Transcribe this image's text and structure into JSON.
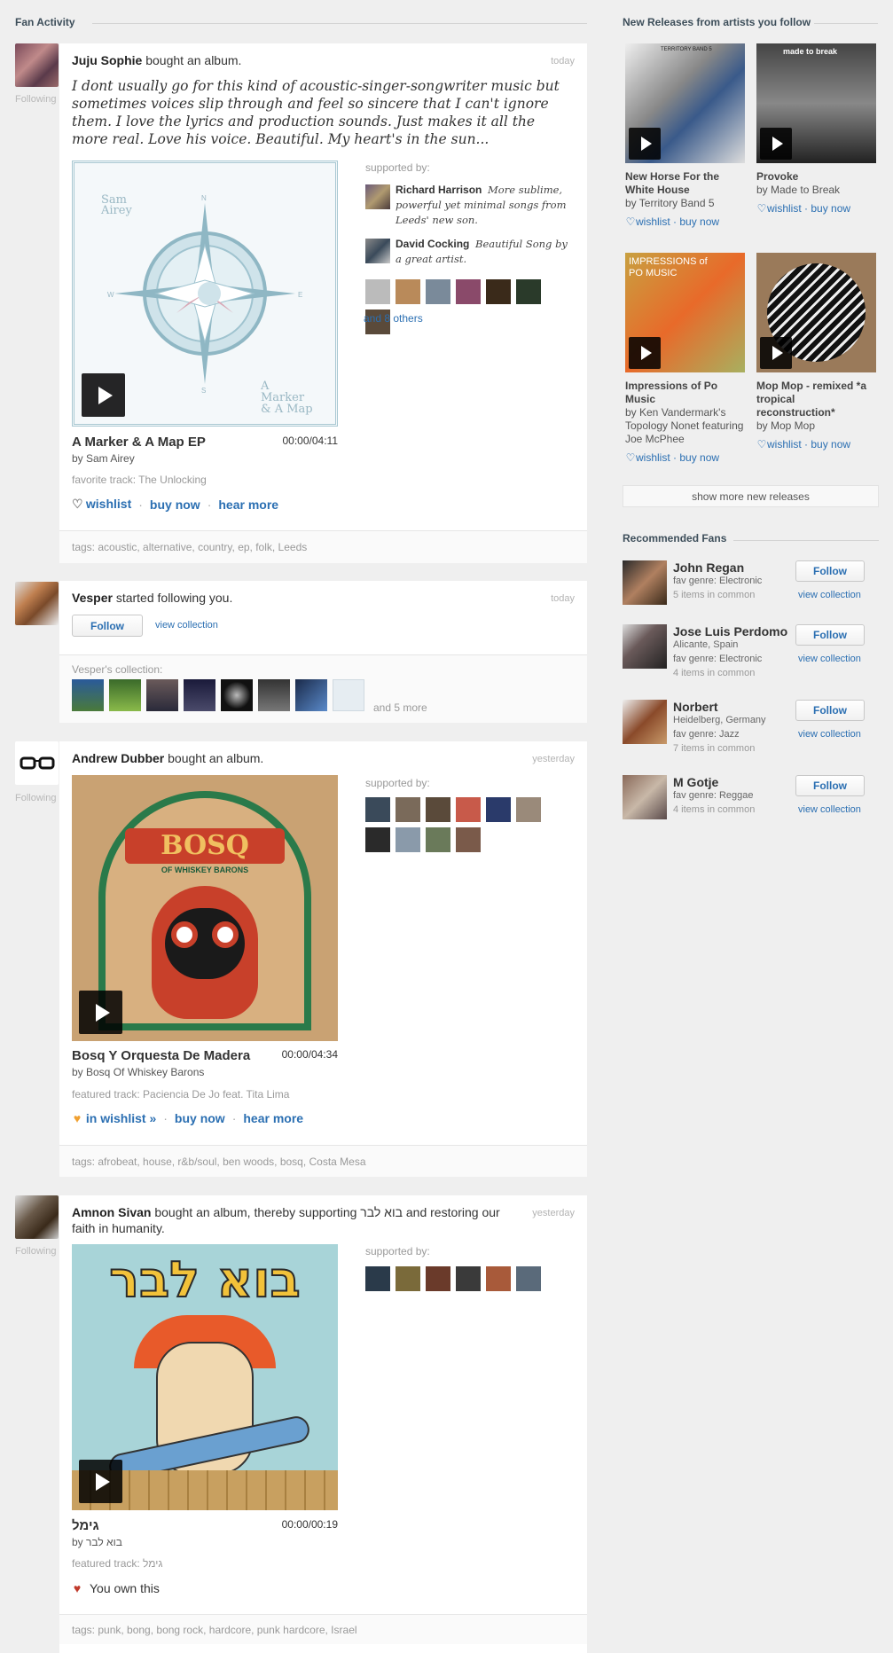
{
  "fan_activity_title": "Fan Activity",
  "new_releases_title": "New Releases from artists you follow",
  "recommended_title": "Recommended Fans",
  "following_label": "Following",
  "story1": {
    "user": "Juju Sophie",
    "action": " bought an album.",
    "date": "today",
    "quote": "I dont usually go for this kind of acoustic-singer-songwriter music but sometimes voices slip through and feel so sincere that I can't ignore them. I love the lyrics and production sounds. Just makes it all the more real. Love his voice. Beautiful. My heart's in the sun...",
    "art_text_top": "Sam Airey",
    "art_text_bottom": "A Marker & A Map",
    "art_n": "N",
    "art_s": "S",
    "art_e": "E",
    "art_w": "W",
    "album_title": "A Marker & A Map EP",
    "time": "00:00/04:11",
    "by": "by Sam Airey",
    "fav_track": "favorite track: The Unlocking",
    "wishlist": "wishlist",
    "buy_now": "buy now",
    "hear_more": "hear more",
    "supported_by": "supported by:",
    "supporters": [
      {
        "name": "Richard Harrison",
        "text": "More sublime, powerful yet minimal songs from Leeds' new son."
      },
      {
        "name": "David Cocking",
        "text": "Beautiful Song by a great artist."
      }
    ],
    "and_others": "and 8 others",
    "tags": "tags: acoustic, alternative, country, ep, folk, Leeds"
  },
  "story2": {
    "user": "Vesper",
    "action": " started following you.",
    "date": "today",
    "follow": "Follow",
    "view_collection": "view collection",
    "collection_label": "Vesper's collection:",
    "and_more": "and 5 more"
  },
  "story3": {
    "user": "Andrew Dubber",
    "action": " bought an album.",
    "date": "yesterday",
    "art_text": "BOSQ",
    "art_sub": "OF WHISKEY BARONS",
    "album_title": "Bosq Y Orquesta De Madera",
    "time": "00:00/04:34",
    "by": "by Bosq Of Whiskey Barons",
    "fav_track": "featured track: Paciencia De Jo feat. Tita Lima",
    "in_wishlist": "in wishlist »",
    "buy_now": "buy now",
    "hear_more": "hear more",
    "supported_by": "supported by:",
    "tags": "tags: afrobeat, house, r&b/soul, ben woods, bosq, Costa Mesa"
  },
  "story4": {
    "user": "Amnon Sivan",
    "action_pre": " bought an album, thereby supporting ",
    "artist": "בוא לבר",
    "action_post": " and restoring our faith in humanity.",
    "date": "yesterday",
    "art_text": "בוא לבר",
    "album_title": "גימל",
    "time": "00:00/00:19",
    "by": "by בוא לבר",
    "fav_track": "featured track: גימל",
    "own": "You own this",
    "supported_by": "supported by:",
    "tags": "tags: punk, bong, bong rock, hardcore, punk hardcore, Israel"
  },
  "releases": [
    {
      "name": "New Horse For the White House",
      "by": "by Territory Band 5",
      "art_text": "TERRITORY BAND 5"
    },
    {
      "name": "Provoke",
      "by": "by Made to Break",
      "art_text": "made to break"
    },
    {
      "name": "Impressions of Po Music",
      "by": "by Ken Vandermark's Topology Nonet featuring Joe McPhee",
      "art_text": "IMPRESSIONS of PO MUSIC"
    },
    {
      "name": "Mop Mop - remixed *a tropical reconstruction*",
      "by": "by Mop Mop",
      "art_text": ""
    }
  ],
  "release_wishlist": "wishlist",
  "release_buy": "buy now",
  "show_more": "show more new releases",
  "fans": [
    {
      "name": "John Regan",
      "line1": "fav genre: Electronic",
      "line2": "",
      "common": "5 items in common"
    },
    {
      "name": "Jose Luis Perdomo",
      "line1": "Alicante, Spain",
      "line2": "fav genre: Electronic",
      "common": "4 items in common"
    },
    {
      "name": "Norbert",
      "line1": "Heidelberg, Germany",
      "line2": "fav genre: Jazz",
      "common": "7 items in common"
    },
    {
      "name": "M Gotje",
      "line1": "fav genre: Reggae",
      "line2": "",
      "common": "4 items in common"
    }
  ],
  "fan_follow": "Follow",
  "fan_view": "view collection",
  "colors": {
    "link": "#2b6fb2",
    "heart": "#f0a030",
    "own_heart": "#c0392b"
  }
}
